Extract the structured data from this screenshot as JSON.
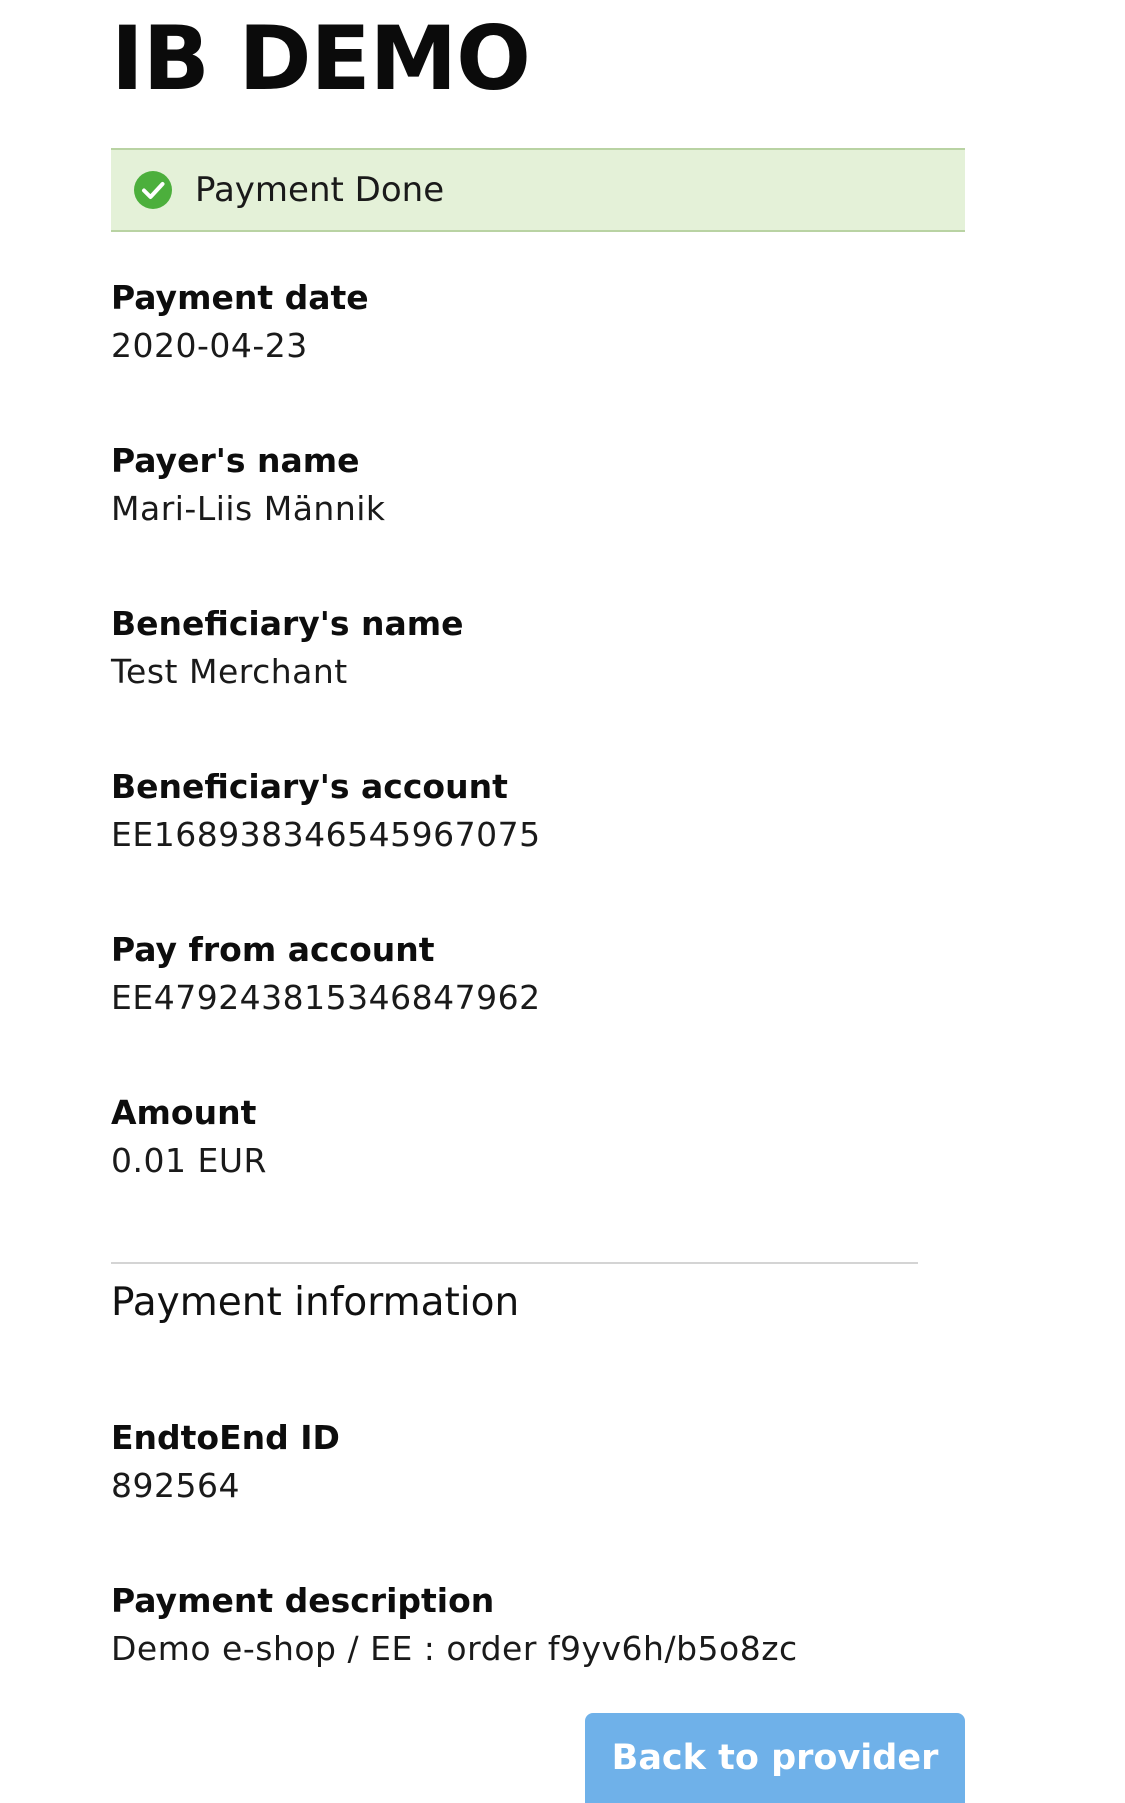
{
  "header": {
    "brand": "IB DEMO"
  },
  "status": {
    "icon": "check-circle-icon",
    "text": "Payment Done",
    "color": "#e4f1d8",
    "icon_color": "#4caf3c"
  },
  "details": [
    {
      "label": "Payment date",
      "value": "2020-04-23"
    },
    {
      "label": "Payer's name",
      "value": "Mari-Liis Männik"
    },
    {
      "label": "Beneficiary's name",
      "value": "Test Merchant"
    },
    {
      "label": "Beneficiary's account",
      "value": "EE168938346545967075"
    },
    {
      "label": "Pay from account",
      "value": "EE479243815346847962"
    },
    {
      "label": "Amount",
      "value": "0.01 EUR"
    }
  ],
  "payment_information": {
    "title": "Payment information",
    "fields": [
      {
        "label": "EndtoEnd ID",
        "value": "892564"
      },
      {
        "label": "Payment description",
        "value": "Demo e-shop / EE : order f9yv6h/b5o8zc"
      }
    ]
  },
  "actions": {
    "back_label": "Back to provider",
    "back_color": "#6fb1e9"
  }
}
